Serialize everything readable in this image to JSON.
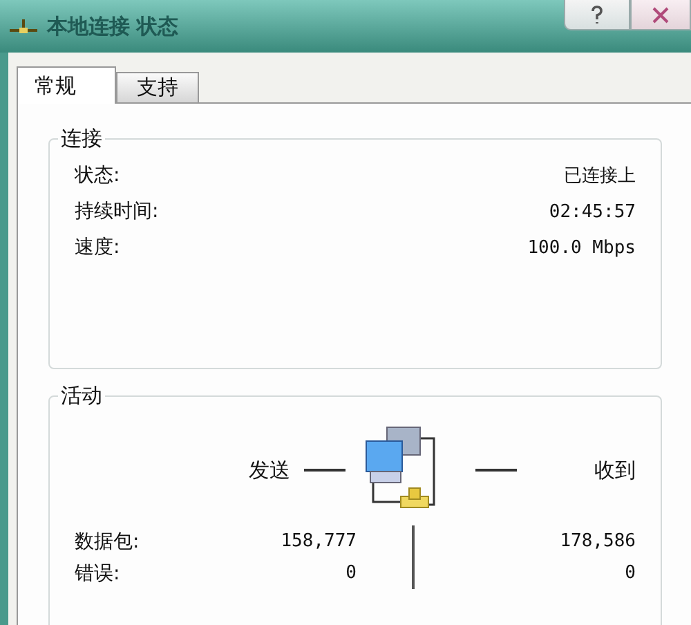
{
  "window": {
    "title": "本地连接 状态"
  },
  "tabs": [
    {
      "label": "常规",
      "selected": true
    },
    {
      "label": "支持",
      "selected": false
    }
  ],
  "connection": {
    "title": "连接",
    "rows": [
      {
        "label": "状态:",
        "value": "已连接上"
      },
      {
        "label": "持续时间:",
        "value": "02:45:57"
      },
      {
        "label": "速度:",
        "value": "100.0 Mbps"
      }
    ]
  },
  "activity": {
    "title": "活动",
    "sent_label": "发送",
    "received_label": "收到",
    "rows": [
      {
        "label": "数据包:",
        "sent": "158,777",
        "received": "178,586"
      },
      {
        "label": "错误:",
        "sent": "0",
        "received": "0"
      }
    ]
  }
}
